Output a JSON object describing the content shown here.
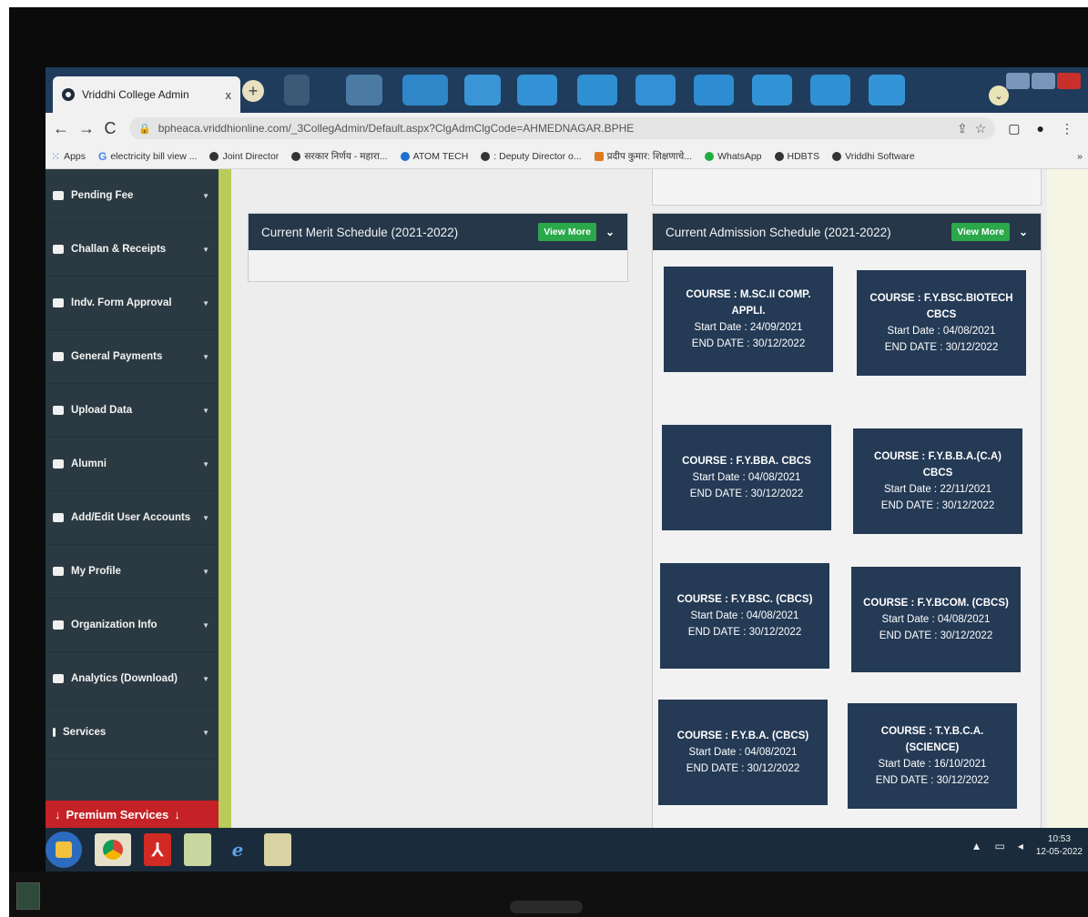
{
  "browser": {
    "tab_title": "Vriddhi College Admin",
    "tab_close": "x",
    "new_tab": "+",
    "url": "bpheaca.vriddhionline.com/_3CollegAdmin/Default.aspx?ClgAdmClgCode=AHMEDNAGAR.BPHE",
    "bookmarks": [
      {
        "label": "Apps",
        "icon": "apps-grid-icon"
      },
      {
        "label": "electricity bill view ...",
        "icon": "google-icon"
      },
      {
        "label": "Joint Director",
        "icon": "globe-icon"
      },
      {
        "label": "सरकार निर्णय - महारा...",
        "icon": "globe-icon"
      },
      {
        "label": "ATOM TECH",
        "icon": "atom-icon"
      },
      {
        "label": ": Deputy Director o...",
        "icon": "globe-icon"
      },
      {
        "label": "प्रदीप कुमार: शिक्षणाचे...",
        "icon": "bookmark-icon"
      },
      {
        "label": "WhatsApp",
        "icon": "whatsapp-icon"
      },
      {
        "label": "HDBTS",
        "icon": "globe-icon"
      },
      {
        "label": "Vriddhi Software",
        "icon": "globe-icon"
      }
    ],
    "more": "»"
  },
  "sidebar": {
    "items": [
      {
        "label": "Pending Fee"
      },
      {
        "label": "Challan & Receipts"
      },
      {
        "label": "Indv. Form Approval"
      },
      {
        "label": "General Payments"
      },
      {
        "label": "Upload Data"
      },
      {
        "label": "Alumni"
      },
      {
        "label": "Add/Edit User Accounts"
      },
      {
        "label": "My Profile"
      },
      {
        "label": "Organization Info"
      },
      {
        "label": "Analytics (Download)"
      },
      {
        "label": "Services"
      }
    ],
    "premium": "Premium Services",
    "premium_arrow": "↓"
  },
  "merit_panel": {
    "title": "Current Merit Schedule (2021-2022)",
    "view_more": "View More",
    "chevron": "⌄"
  },
  "admission_panel": {
    "title": "Current Admission Schedule (2021-2022)",
    "view_more": "View More",
    "chevron": "⌄",
    "courses": [
      {
        "course": "COURSE : M.SC.II COMP. APPLI.",
        "start": "Start Date : 24/09/2021",
        "end": "END DATE : 30/12/2022"
      },
      {
        "course": "COURSE : F.Y.BSC.BIOTECH CBCS",
        "start": "Start Date : 04/08/2021",
        "end": "END DATE : 30/12/2022"
      },
      {
        "course": "COURSE : F.Y.BBA. CBCS",
        "start": "Start Date : 04/08/2021",
        "end": "END DATE : 30/12/2022"
      },
      {
        "course": "COURSE : F.Y.B.B.A.(C.A) CBCS",
        "start": "Start Date : 22/11/2021",
        "end": "END DATE : 30/12/2022"
      },
      {
        "course": "COURSE : F.Y.BSC. (CBCS)",
        "start": "Start Date : 04/08/2021",
        "end": "END DATE : 30/12/2022"
      },
      {
        "course": "COURSE : F.Y.BCOM. (CBCS)",
        "start": "Start Date : 04/08/2021",
        "end": "END DATE : 30/12/2022"
      },
      {
        "course": "COURSE : F.Y.B.A. (CBCS)",
        "start": "Start Date : 04/08/2021",
        "end": "END DATE : 30/12/2022"
      },
      {
        "course": "COURSE : T.Y.B.C.A. (SCIENCE)",
        "start": "Start Date : 16/10/2021",
        "end": "END DATE : 30/12/2022"
      }
    ]
  },
  "taskbar": {
    "time": "10:53",
    "date": "12-05-2022",
    "ie_glyph": "e"
  },
  "colors": {
    "sidebar": "#2b3a42",
    "panel_header": "#253749",
    "course_card": "#243a55",
    "view_more": "#2aa84a",
    "premium": "#c42226"
  }
}
